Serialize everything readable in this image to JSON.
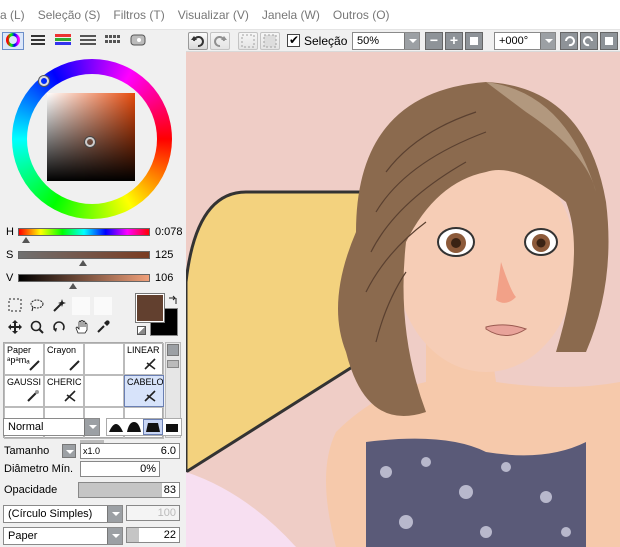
{
  "menu": [
    "a (L)",
    "Seleção (S)",
    "Filtros (T)",
    "Visualizar (V)",
    "Janela (W)",
    "Outros (O)"
  ],
  "toolbar": {
    "selection_label": "Seleção",
    "selection_checked": true,
    "zoom": "50%",
    "rotation": "+000°"
  },
  "color": {
    "h_label": "H",
    "h_value": "0:078",
    "h_fraction": 0.06,
    "s_label": "S",
    "s_value": "125",
    "s_fraction": 0.49,
    "v_label": "V",
    "v_value": "106",
    "v_fraction": 0.42,
    "primary": "#62402f",
    "secondary": "#000000"
  },
  "brushes": [
    {
      "name": "Paper",
      "sub": "ᵃpᵃmₐ"
    },
    {
      "name": "Crayon",
      "sub": ""
    },
    {
      "name": "",
      "sub": ""
    },
    {
      "name": "LINEAR",
      "sub": ""
    },
    {
      "name": "GAUSSI",
      "sub": ""
    },
    {
      "name": "CHERIC",
      "sub": ""
    },
    {
      "name": "",
      "sub": ""
    },
    {
      "name": "CABELO",
      "sub": ""
    }
  ],
  "brush_settings": {
    "blend_mode": "Normal",
    "size_label": "Tamanho",
    "size_multiplier": "x1.0",
    "size_value": "6.0",
    "min_diameter_label": "Diâmetro Mín.",
    "min_diameter_value": "0%",
    "opacity_label": "Opacidade",
    "opacity_value": "83",
    "opacity_fraction": 0.83,
    "shape": "(Círculo Simples)",
    "shape_value": "100",
    "texture": "Paper",
    "texture_value": "22"
  }
}
